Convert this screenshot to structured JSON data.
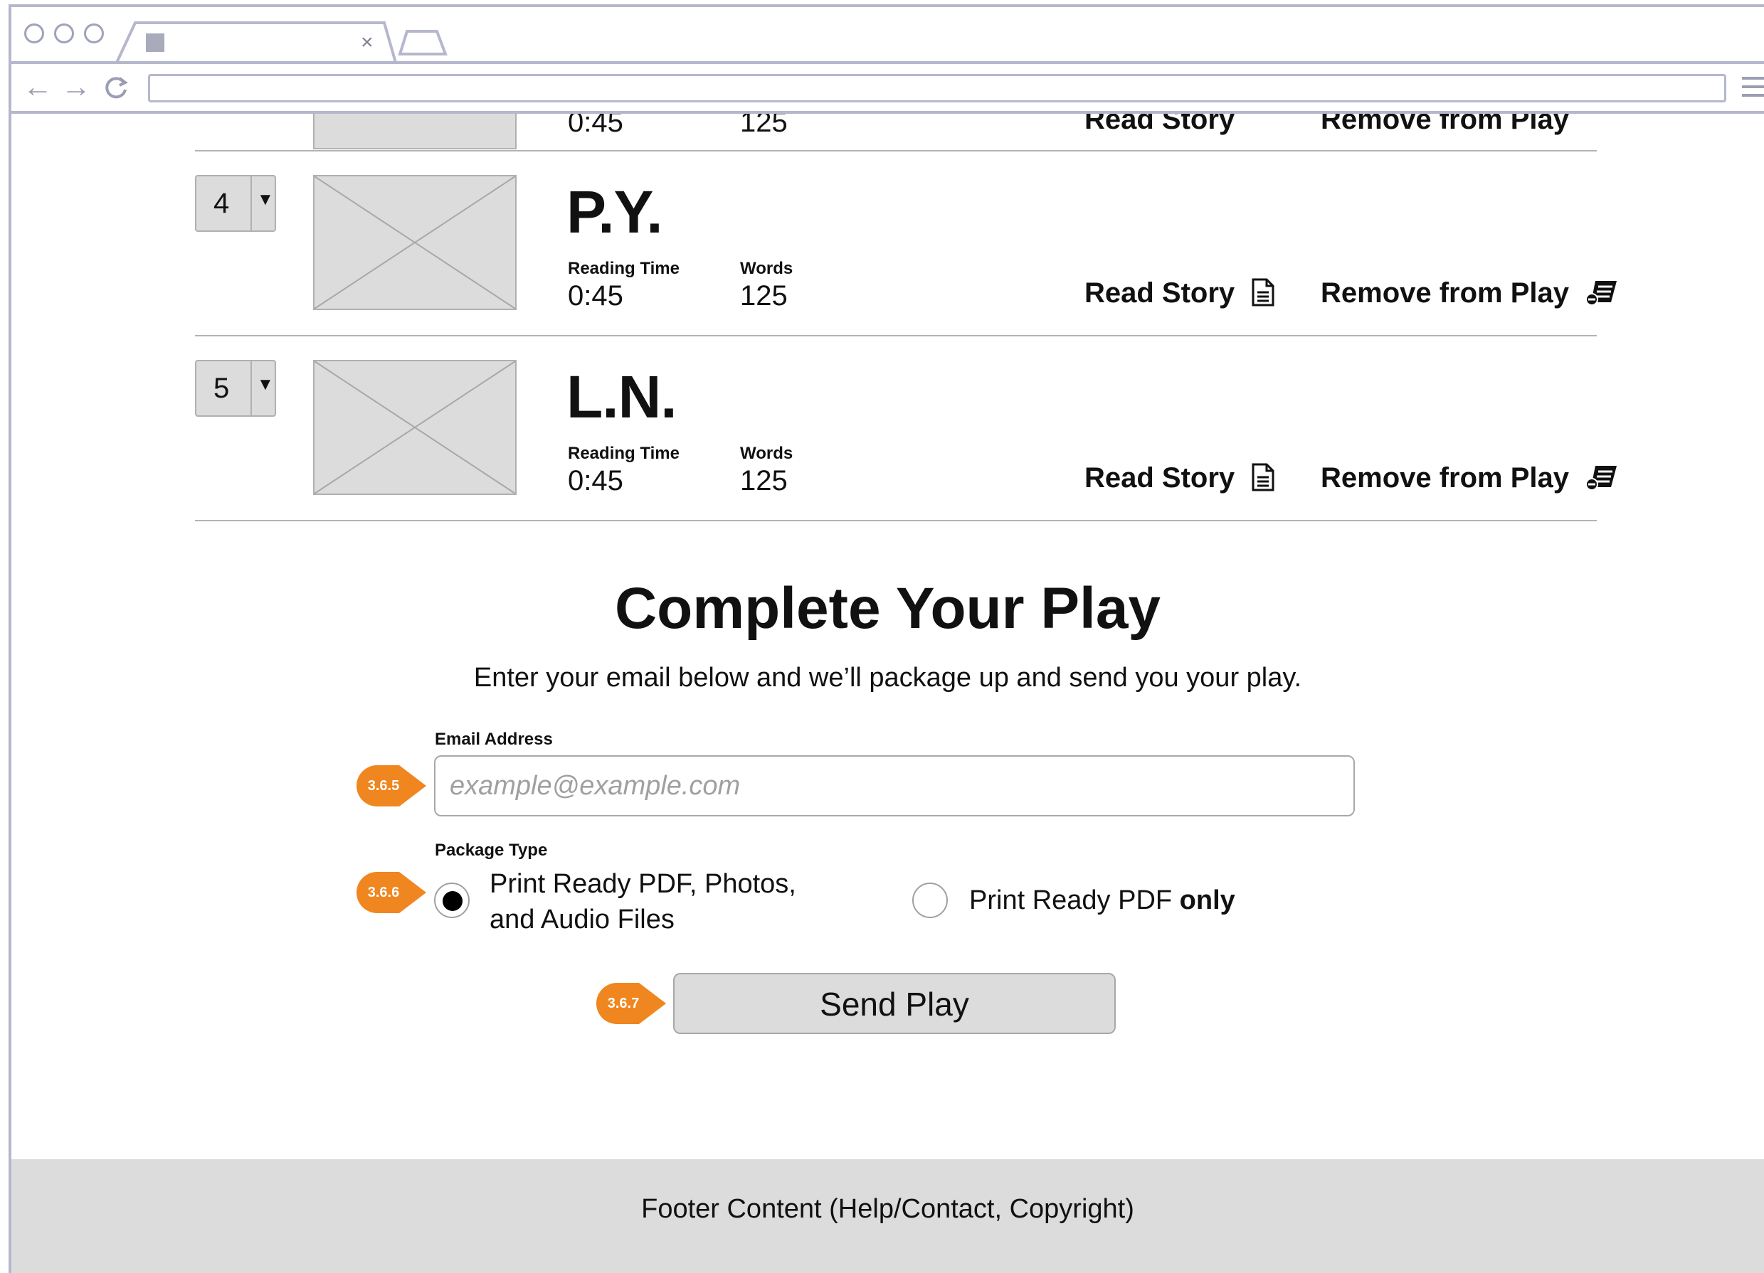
{
  "browser": {
    "tab_close": "×",
    "nav_back": "←",
    "nav_forward": "→",
    "nav_reload": "C",
    "address_value": ""
  },
  "partial_row": {
    "reading_time_value": "0:45",
    "words_value": "125",
    "read_story": "Read Story",
    "remove": "Remove from Play"
  },
  "stories": [
    {
      "order": "4",
      "title": "P.Y.",
      "reading_time_label": "Reading Time",
      "reading_time_value": "0:45",
      "words_label": "Words",
      "words_value": "125",
      "read_story": "Read Story",
      "remove": "Remove from Play"
    },
    {
      "order": "5",
      "title": "L.N.",
      "reading_time_label": "Reading Time",
      "reading_time_value": "0:45",
      "words_label": "Words",
      "words_value": "125",
      "read_story": "Read Story",
      "remove": "Remove from Play"
    }
  ],
  "form": {
    "title": "Complete Your Play",
    "subtitle": "Enter your email below and we’ll package up and send you your play.",
    "email_label": "Email Address",
    "email_placeholder": "example@example.com",
    "package_label": "Package Type",
    "option_full_line1": "Print Ready PDF, Photos,",
    "option_full_line2": "and Audio Files",
    "option_pdf_prefix": "Print Ready PDF ",
    "option_pdf_bold": "only",
    "selected_option": "full",
    "send_label": "Send Play"
  },
  "callouts": {
    "email": "3.6.5",
    "package": "3.6.6",
    "send": "3.6.7",
    "color": "#f0861f"
  },
  "footer": {
    "text": "Footer Content (Help/Contact, Copyright)"
  }
}
